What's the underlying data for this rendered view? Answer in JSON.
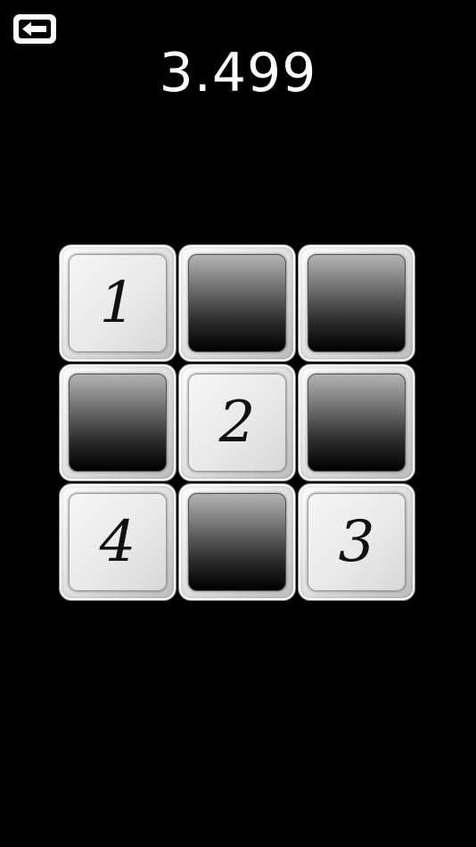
{
  "header": {
    "back_icon": "left-arrow-icon",
    "timer": "3.499"
  },
  "board": {
    "rows": 3,
    "cols": 3,
    "tiles": [
      {
        "state": "revealed",
        "number": "1"
      },
      {
        "state": "hidden",
        "number": ""
      },
      {
        "state": "hidden",
        "number": ""
      },
      {
        "state": "hidden",
        "number": ""
      },
      {
        "state": "revealed",
        "number": "2"
      },
      {
        "state": "hidden",
        "number": ""
      },
      {
        "state": "revealed",
        "number": "4"
      },
      {
        "state": "hidden",
        "number": ""
      },
      {
        "state": "revealed",
        "number": "3"
      }
    ]
  },
  "colors": {
    "background": "#000000",
    "text": "#ffffff",
    "tile_light": "#e8e8e8",
    "tile_dark": "#1a1a1a"
  }
}
